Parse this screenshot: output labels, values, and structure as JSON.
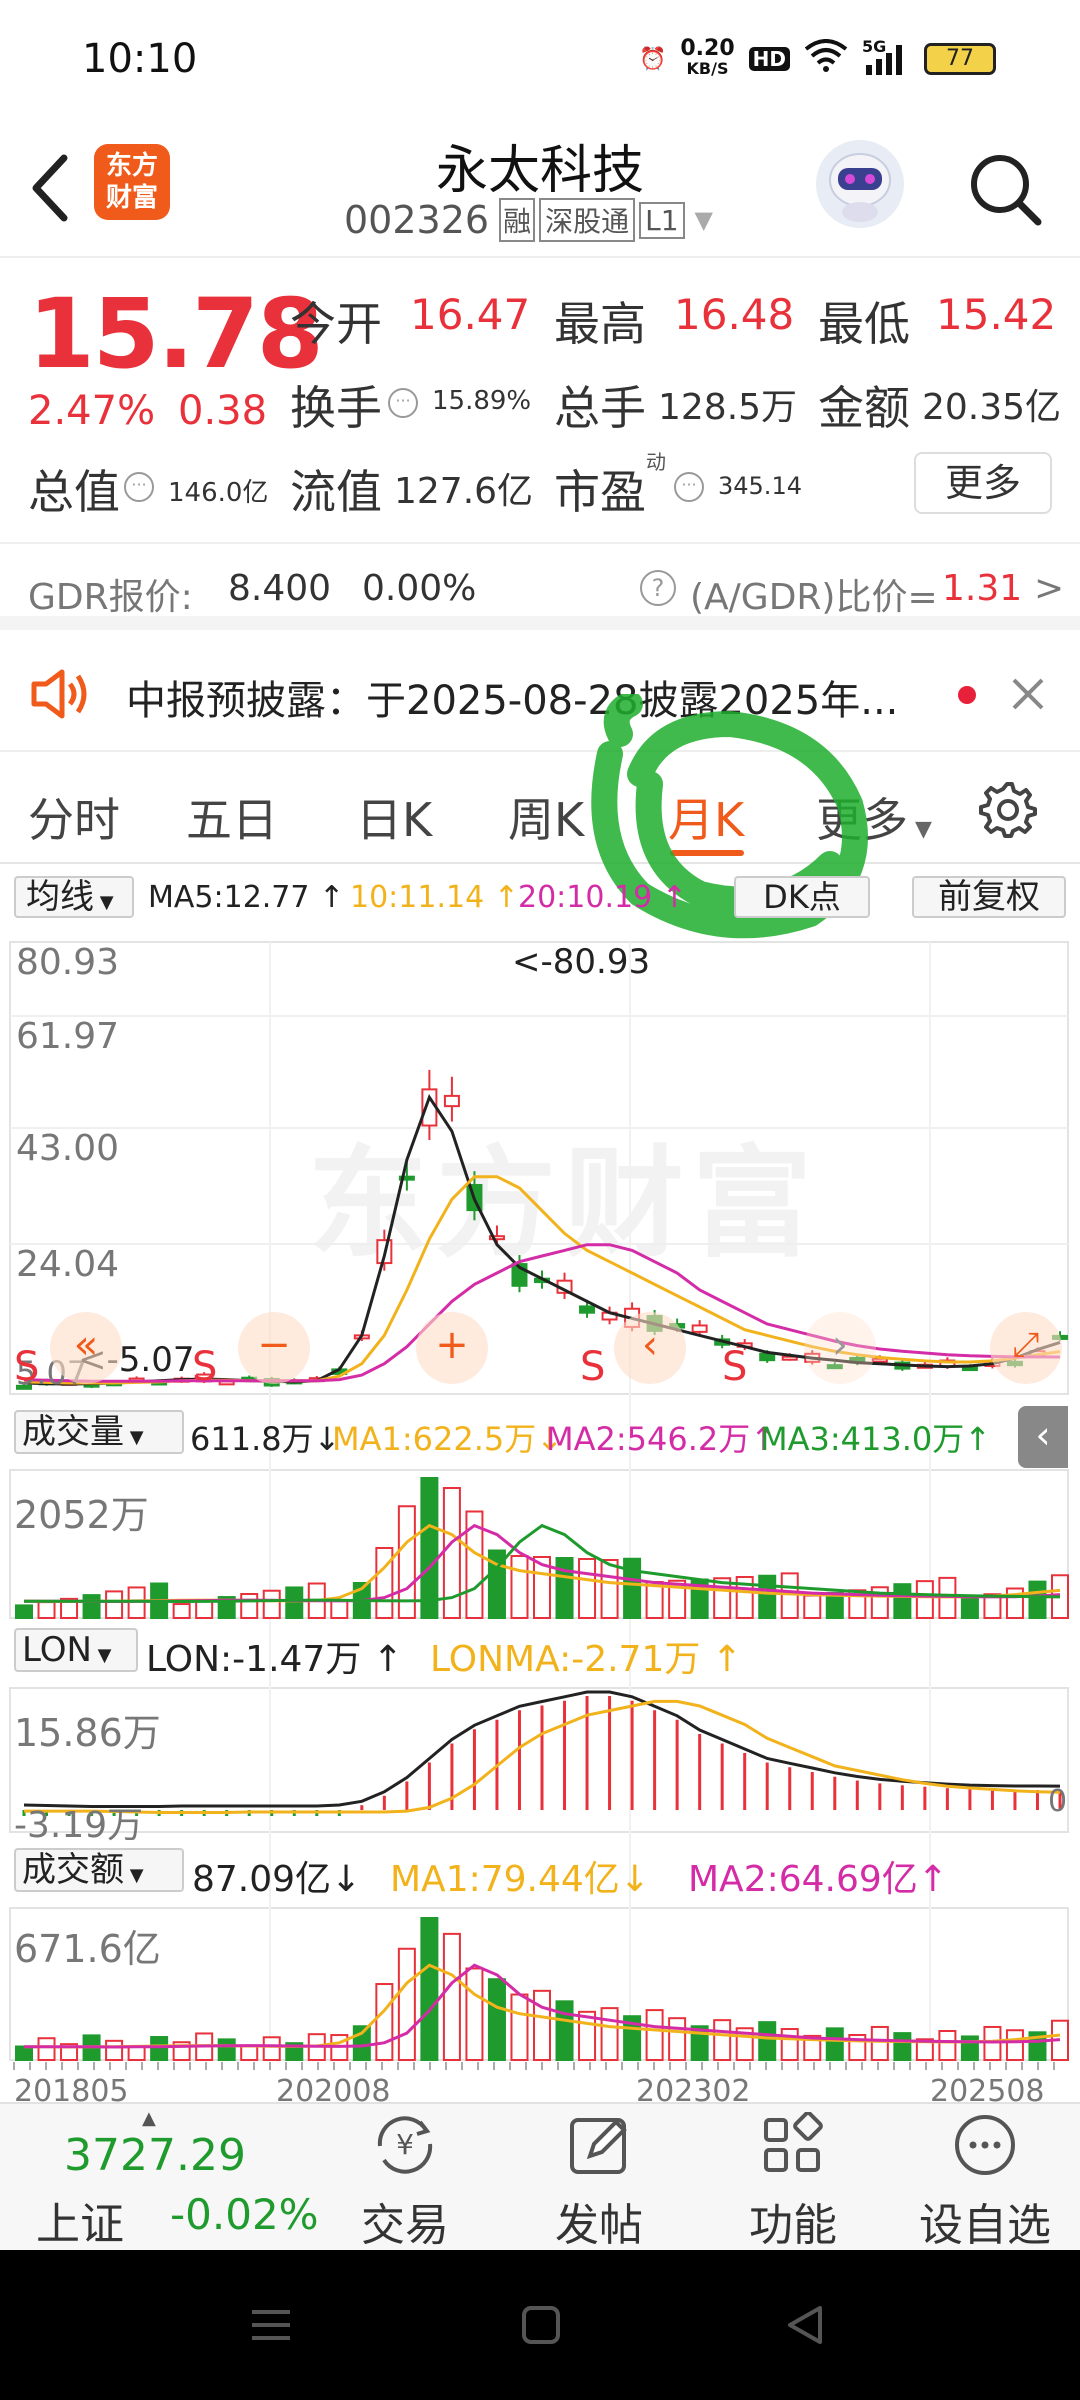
{
  "status_bar": {
    "time": "10:10",
    "net_speed_value": "0.20",
    "net_speed_unit": "KB/S",
    "hd": "HD",
    "signal_label": "5G",
    "battery": "77"
  },
  "header": {
    "logo_line1": "东方",
    "logo_line2": "财富",
    "stock_name": "永太科技",
    "stock_code": "002326",
    "tags": [
      "融",
      "深股通",
      "L1"
    ]
  },
  "quote": {
    "price": "15.78",
    "change_pct": "2.47%",
    "change_amt": "0.38",
    "open_label": "今开",
    "open": "16.47",
    "high_label": "最高",
    "high": "16.48",
    "low_label": "最低",
    "low": "15.42",
    "turnover_label": "换手",
    "turnover": "15.89%",
    "volume_label": "总手",
    "volume": "128.5万",
    "amount_label": "金额",
    "amount": "20.35亿",
    "mktcap_label": "总值",
    "mktcap": "146.0亿",
    "float_label": "流值",
    "float_cap": "127.6亿",
    "pe_label": "市盈",
    "pe_sup": "动",
    "pe": "345.14",
    "more_label": "更多"
  },
  "gdr": {
    "label": "GDR报价:",
    "price": "8.400",
    "pct": "0.00%",
    "ratio_label": "(A/GDR)比价=",
    "ratio": "1.31",
    "arrow": ">"
  },
  "notice": {
    "text": "中报预披露：于2025-08-28披露2025年..."
  },
  "tabs": [
    "分时",
    "五日",
    "日K",
    "周K",
    "月K",
    "更多"
  ],
  "active_tab": "月K",
  "chart_toolbar": {
    "ma_select": "均线",
    "ma5": "MA5:12.77 ↑",
    "ma10": "10:11.14 ↑",
    "ma20": "20:10.19 ↑",
    "dk_button": "DK点",
    "adjust_button": "前复权"
  },
  "candle_panel": {
    "y_labels": [
      "80.93",
      "61.97",
      "43.00",
      "24.04",
      "5.07"
    ],
    "max_marker": "<-80.93",
    "min_marker": "<-5.07",
    "signals": [
      "S",
      "S",
      "S",
      "S"
    ]
  },
  "volume_panel": {
    "select": "成交量",
    "value": "611.8万↓",
    "ma1": "MA1:622.5万↓",
    "ma2": "MA2:546.2万↑",
    "ma3": "MA3:413.0万↑",
    "y_top": "2052万"
  },
  "lon_panel": {
    "select": "LON",
    "value": "LON:-1.47万 ↑",
    "lonma": "LONMA:-2.71万 ↑",
    "y_top": "15.86万",
    "y_bottom": "-3.19万",
    "zero": "0"
  },
  "amount_panel": {
    "select": "成交额",
    "value": "87.09亿↓",
    "ma1": "MA1:79.44亿↓",
    "ma2": "MA2:64.69亿↑",
    "y_top": "671.6亿",
    "x_labels": [
      "201805",
      "202008",
      "202302",
      "202508"
    ]
  },
  "bottom_bar": {
    "index_value": "3727.29",
    "index_name": "上证",
    "index_change": "-0.02%",
    "items": [
      "交易",
      "发帖",
      "功能",
      "设自选"
    ]
  },
  "watermark": "东方财富",
  "colors": {
    "up": "#e8313a",
    "down": "#1f9b2e",
    "ma5": "#222222",
    "ma10": "#f2b21c",
    "ma20": "#d42ca6",
    "accent": "#f05a1a"
  },
  "chart_data": [
    {
      "type": "candlestick",
      "title": "",
      "period": "monthly",
      "ylim": [
        5.07,
        80.93
      ],
      "x_ticks": [
        "201805",
        "202008",
        "202302",
        "202508"
      ],
      "series": [
        {
          "name": "MA5",
          "values": [
            5.6,
            5.5,
            5.4,
            5.5,
            5.6,
            5.8,
            6.0,
            6.2,
            6.3,
            6.2,
            6.0,
            5.9,
            5.8,
            6.0,
            8.0,
            14,
            28,
            45,
            56,
            50,
            38,
            30,
            26,
            24,
            22,
            20,
            18,
            17,
            16,
            15,
            14,
            13,
            12,
            11,
            10.5,
            10,
            9.6,
            9.2,
            9,
            8.8,
            8.6,
            8.5,
            8.6,
            9,
            10,
            11.5,
            12.77
          ]
        },
        {
          "name": "MA10",
          "values": [
            5.8,
            5.7,
            5.6,
            5.6,
            5.6,
            5.7,
            5.8,
            6.0,
            6.1,
            6.1,
            6.0,
            6.0,
            6.0,
            6.0,
            6.8,
            9,
            14,
            22,
            31,
            38,
            42,
            42,
            40,
            36,
            32,
            29,
            27,
            25,
            23,
            21,
            19,
            17,
            15,
            14,
            13,
            12,
            11.2,
            10.6,
            10.1,
            9.8,
            9.5,
            9.3,
            9.3,
            9.5,
            10,
            10.6,
            11.14
          ]
        },
        {
          "name": "MA20",
          "values": [
            6.2,
            6.1,
            6.0,
            5.9,
            5.9,
            5.9,
            5.9,
            6.0,
            6.0,
            6.0,
            6.0,
            6.0,
            6.0,
            6.0,
            6.2,
            7.0,
            9,
            12,
            16,
            20,
            23,
            25,
            27,
            28,
            29,
            30,
            30,
            29,
            27,
            25,
            22,
            20,
            18,
            16,
            15,
            14,
            13,
            12.2,
            11.6,
            11.2,
            10.9,
            10.6,
            10.4,
            10.3,
            10.2,
            10.2,
            10.19
          ]
        }
      ]
    },
    {
      "type": "bar",
      "title": "成交量",
      "ylim": [
        0,
        2052
      ],
      "unit": "万"
    },
    {
      "type": "line",
      "title": "LON",
      "ylim": [
        -3.19,
        15.86
      ],
      "unit": "万"
    },
    {
      "type": "bar",
      "title": "成交额",
      "ylim": [
        0,
        671.6
      ],
      "unit": "亿"
    }
  ]
}
